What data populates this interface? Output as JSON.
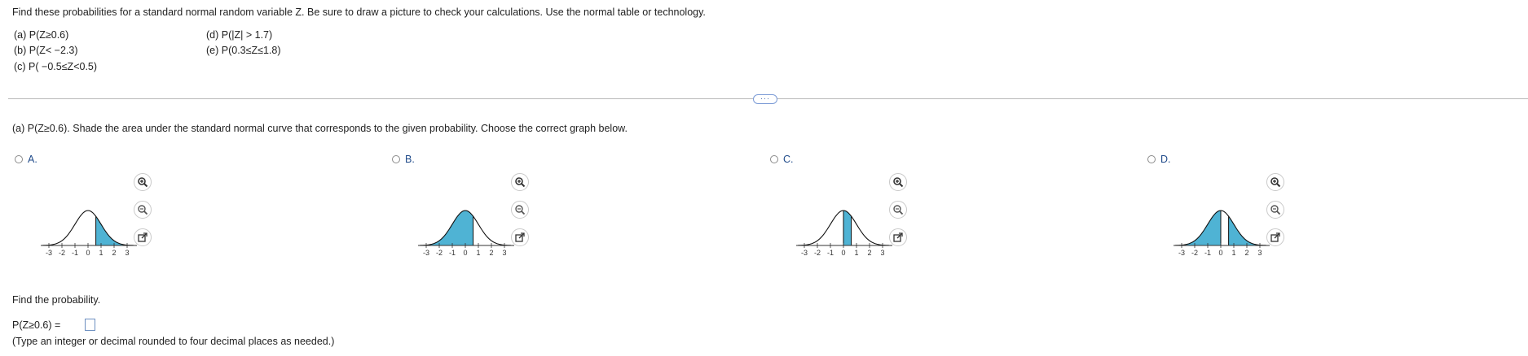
{
  "question": {
    "instructions": "Find these probabilities for a standard normal random variable Z. Be sure to draw a picture to check your calculations. Use the normal table or technology.",
    "parts_left": [
      "(a) P(Z≥0.6)",
      "(b) P(Z< −2.3)",
      "(c) P( −0.5≤Z<0.5)"
    ],
    "parts_right": [
      "(d) P(|Z| > 1.7)",
      "(e) P(0.3≤Z≤1.8)"
    ]
  },
  "more_button": "···",
  "part_a": {
    "prompt": "(a) P(Z≥0.6). Shade the area under the standard normal curve that corresponds to the given probability. Choose the correct graph below.",
    "choices": [
      {
        "label": "A.",
        "shade": "right_of_0.6"
      },
      {
        "label": "B.",
        "shade": "left_of_0.6"
      },
      {
        "label": "C.",
        "shade": "between_0_and_0.6"
      },
      {
        "label": "D.",
        "shade": "outside_0_to_0.6"
      }
    ],
    "axis_ticks": [
      "-3",
      "-2",
      "-1",
      "0",
      "1",
      "2",
      "3"
    ],
    "find_label": "Find the probability.",
    "answer_prefix": "P(Z≥0.6) =",
    "answer_value": "",
    "hint": "(Type an integer or decimal rounded to four decimal places as needed.)"
  },
  "colors": {
    "shade": "#4fb3d4",
    "link": "#1f4a8a"
  },
  "icons": [
    "zoom-in-icon",
    "zoom-out-icon",
    "open-new-window-icon"
  ]
}
